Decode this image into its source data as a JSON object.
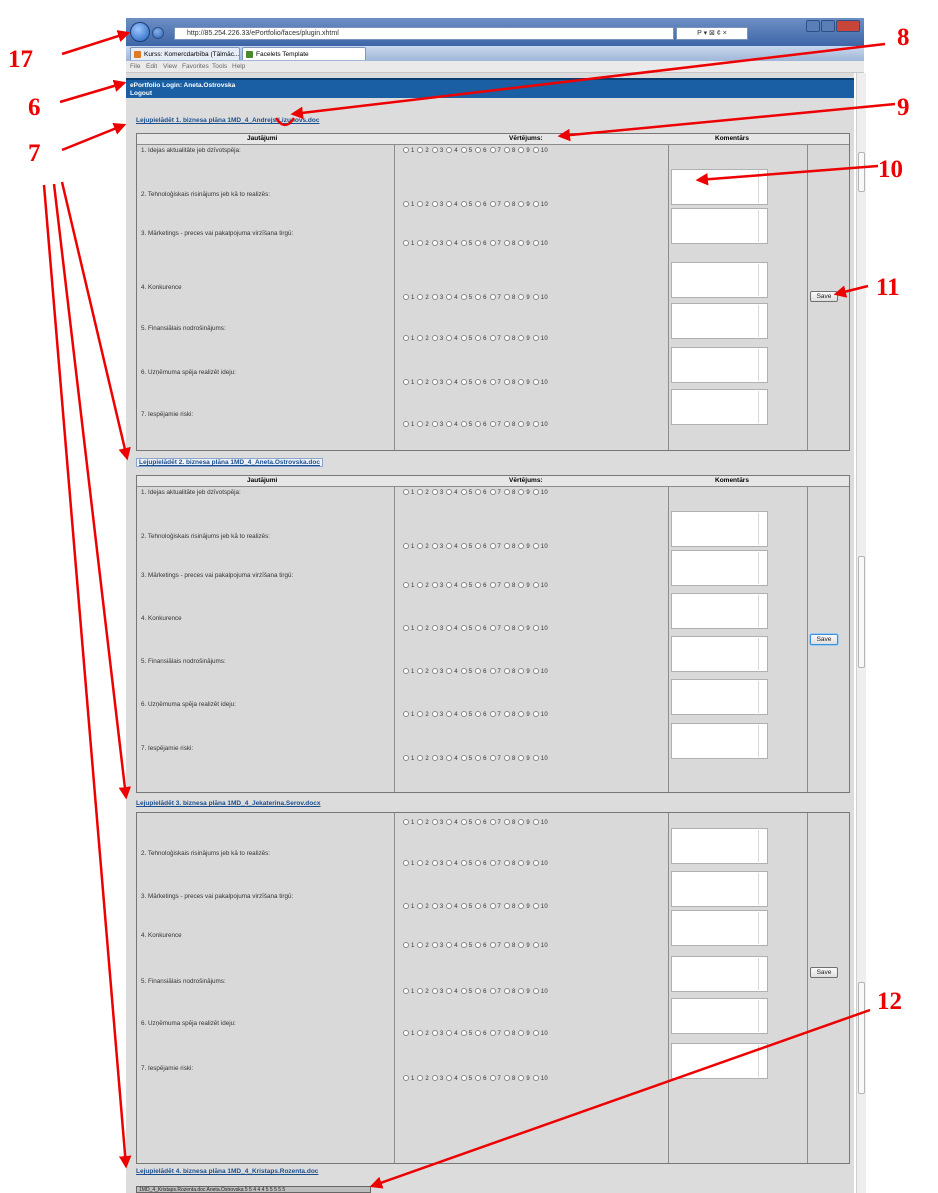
{
  "browser": {
    "url": "http://85.254.226.33/ePortfolio/faces/plugin.xhtml",
    "search_tools": "P ▾ ⊠ ¢ ×",
    "tabs": [
      "Kurss: Komercdarbība (Tālmāc...",
      "Facelets Template"
    ],
    "menu": [
      "File",
      "Edit",
      "View",
      "Favorites",
      "Tools",
      "Help"
    ]
  },
  "header": {
    "login": "ePortfolio Login: Aneta.Ostrovska",
    "logout": "Logout"
  },
  "table_headers": {
    "questions": "Jautājumi",
    "ratings": "Vērtējums:",
    "comments": "Komentārs"
  },
  "questions": [
    "1. Idejas aktualitāte jeb dzīvotspēja:",
    "2. Tehnoloģiskais risinājums jeb kā to realizēs:",
    "3. Mārketings - preces vai pakalpojuma virzīšana tirgū:",
    "4. Konkurence",
    "5. Finansiālais nodrošinājums:",
    "6. Uzņēmuma spēja realizēt ideju:",
    "7. Iespējamie riski:"
  ],
  "rating_scale": [
    "1",
    "2",
    "3",
    "4",
    "5",
    "6",
    "7",
    "8",
    "9",
    "10"
  ],
  "save_label": "Save",
  "sections": [
    {
      "link": "Lejupielādēt 1. biznesa plāna 1MD_4_Andrejs.Lizunovs.doc"
    },
    {
      "link": "Lejupielādēt 2. biznesa plāna 1MD_4_Aneta.Ostrovska.doc"
    },
    {
      "link": "Lejupielādēt 3. biznesa plāna 1MD_4_Jekaterina.Serov.docx"
    },
    {
      "link": "Lejupielādēt 4. biznesa plāna 1MD_4_Kristaps.Rozenta.doc"
    }
  ],
  "bottom_strip": "1MD_4_Kristaps.Rozenta.doc Aneta.Ostrovska 5 5 4 4 4 5 5 5 5 5",
  "annotations": [
    "17",
    "6",
    "7",
    "8",
    "9",
    "10",
    "11",
    "12"
  ],
  "annotation_color": "#e00000"
}
